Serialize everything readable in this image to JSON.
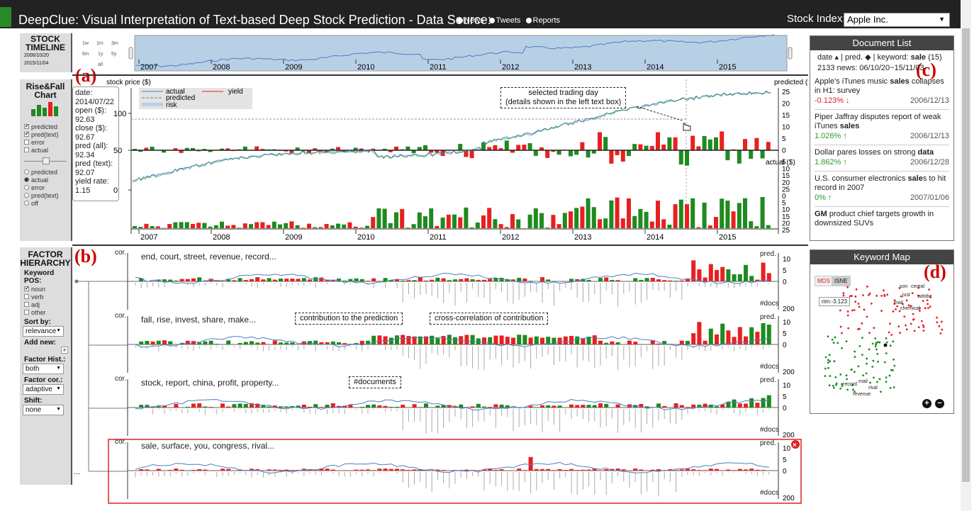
{
  "header": {
    "title": "DeepClue: Visual Interpretation of Text-based Deep Stock Prediction - ",
    "data_source_label": "Data Source:",
    "sources": [
      "News",
      "Tweets",
      "Reports"
    ],
    "stock_index_label": "Stock Index:",
    "stock_index_value": "Apple Inc."
  },
  "timeline_panel": {
    "title_line1": "STOCK",
    "title_line2": "TIMELINE",
    "zoom_levels": [
      "1w",
      "1m",
      "3m",
      "6m",
      "1y",
      "5y",
      "all"
    ],
    "start_date": "2006/10/20",
    "end_date": "2015/11/04"
  },
  "years": [
    "2007",
    "2008",
    "2009",
    "2010",
    "2011",
    "2012",
    "2013",
    "2014",
    "2015"
  ],
  "risefall_panel": {
    "title_line1": "Rise&Fall",
    "title_line2": "Chart",
    "top_options": [
      {
        "label": "predicted",
        "checked": true
      },
      {
        "label": "pred(text)",
        "checked": true
      },
      {
        "label": "error",
        "checked": false
      },
      {
        "label": "actual",
        "checked": false
      }
    ],
    "bottom_options": [
      {
        "label": "predicted",
        "selected": false
      },
      {
        "label": "actual",
        "selected": true
      },
      {
        "label": "error",
        "selected": false
      },
      {
        "label": "pred(text)",
        "selected": false
      },
      {
        "label": "off",
        "selected": false
      }
    ]
  },
  "main_chart": {
    "left_axis_label": "stock price ($)",
    "right_axis_top_label": "predicted ($)",
    "right_axis_bottom_label": "actual ($)",
    "legend": {
      "actual": "actual",
      "predicted": "predicted",
      "risk": "risk",
      "yield": "yield"
    },
    "left_ticks": [
      "100",
      "50",
      "0"
    ],
    "right_top_ticks": [
      "25",
      "20",
      "15",
      "10",
      "5",
      "0"
    ],
    "right_bottom_ticks": [
      "5",
      "10",
      "15",
      "20",
      "25",
      "0",
      "5",
      "10",
      "15",
      "20",
      "25"
    ]
  },
  "info_box": {
    "lines": [
      "date:",
      "2014/07/22",
      "open ($):",
      "92.63",
      "close ($):",
      "92.67",
      "pred (all):",
      "92.34",
      "pred (text):",
      "92.07",
      "yield rate:",
      "1.15"
    ]
  },
  "annotations": {
    "selected_day_line1": "selected trading day",
    "selected_day_line2": "(details shown in the left text box)",
    "contribution": "contribution to the prediction",
    "cross_correlation": "cross-correlation of contribution",
    "documents": "#documents"
  },
  "panel_labels": {
    "a": "(a)",
    "b": "(b)",
    "c": "(c)",
    "d": "(d)"
  },
  "factor_panel": {
    "title_line1": "FACTOR",
    "title_line2": "HIERARCHY",
    "pos_label": "Keyword POS:",
    "pos_options": [
      {
        "label": "noun",
        "checked": true
      },
      {
        "label": "verb",
        "checked": false
      },
      {
        "label": "adj",
        "checked": false
      },
      {
        "label": "other",
        "checked": false
      }
    ],
    "sort_label": "Sort by:",
    "sort_value": "relevance",
    "add_label": "Add new:",
    "hist_label": "Factor Hist.:",
    "hist_value": "both",
    "cor_label": "Factor cor.:",
    "cor_value": "adaptive",
    "shift_label": "Shift:",
    "shift_value": "none",
    "ellipsis": "..."
  },
  "factors": [
    {
      "keywords": "end, court, street, revenue, record...",
      "cor": "cor.",
      "pred": "pred.",
      "docs": "#docs",
      "ticks": [
        "10",
        "5",
        "0",
        "200"
      ]
    },
    {
      "keywords": "fall, rise, invest, share, make...",
      "cor": "cor.",
      "pred": "pred.",
      "docs": "#docs",
      "ticks": [
        "10",
        "5",
        "0",
        "200"
      ]
    },
    {
      "keywords": "stock, report, china, profit, property...",
      "cor": "cor.",
      "pred": "pred.",
      "docs": "#docs",
      "ticks": [
        "10",
        "5",
        "0",
        "200"
      ]
    },
    {
      "keywords": "sale, surface, you, congress, rival...",
      "cor": "cor.",
      "pred": "pred.",
      "docs": "#docs",
      "ticks": [
        "10",
        "5",
        "0",
        "200"
      ]
    }
  ],
  "document_list": {
    "title": "Document List",
    "sort_text": "date ▴ | pred. ◆ | keyword:",
    "keyword": "sale",
    "keyword_count": "(15)",
    "range": "2133 news: 06/10/20~15/11/03",
    "docs": [
      {
        "pre": "Apple's iTunes music ",
        "bold": "sales",
        "post": " collapses in H1: survey",
        "change": "-0.123% ↓",
        "dir": "down",
        "date": "2006/12/13"
      },
      {
        "pre": "Piper Jaffray disputes report of weak iTunes ",
        "bold": "sales",
        "post": "",
        "change": "1.026% ↑",
        "dir": "up",
        "date": "2006/12/13"
      },
      {
        "pre": "Dollar pares losses on strong ",
        "bold": "data",
        "post": "",
        "change": "1.862% ↑",
        "dir": "up",
        "date": "2006/12/28"
      },
      {
        "pre": "U.S. consumer electronics ",
        "bold": "sale",
        "post": "s to hit record in 2007",
        "change": "0% ↑",
        "dir": "up",
        "date": "2007/01/06"
      },
      {
        "pre": "",
        "bold": "GM",
        "post": " product chief targets growth in downsized SUVs",
        "change": "",
        "dir": "",
        "date": ""
      }
    ]
  },
  "keyword_map": {
    "title": "Keyword Map",
    "toggle_mds": "MDS",
    "toggle_tsne": "tSNE",
    "tooltip": "rim:-3.123",
    "labels": [
      "son",
      "cereal",
      "just",
      "adobe",
      "mail",
      "chemical",
      "record",
      "mail",
      "rival",
      "revenue"
    ],
    "zoom_in": "+",
    "zoom_out": "−"
  },
  "colors": {
    "header": "#222222",
    "green": "#1f8a1f",
    "red": "#e82020",
    "line": "#4a7fc0",
    "risk": "#b8d0e6"
  }
}
